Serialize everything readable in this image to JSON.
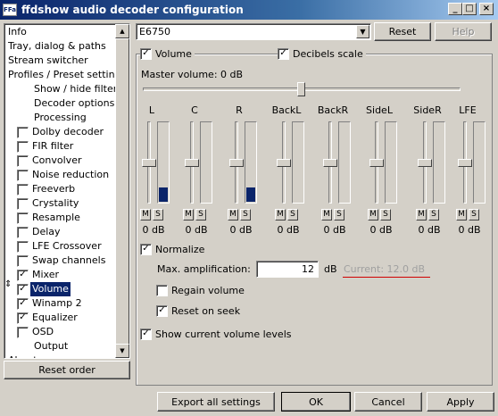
{
  "window": {
    "title": "ffdshow audio decoder configuration",
    "icon_text": "FFa",
    "minimize_glyph": "_",
    "maximize_glyph": "□",
    "close_glyph": "×"
  },
  "tree": {
    "items": [
      {
        "label": "Info",
        "indent": 0,
        "checkbox": false
      },
      {
        "label": "Tray, dialog & paths",
        "indent": 0,
        "checkbox": false
      },
      {
        "label": "Stream switcher",
        "indent": 0,
        "checkbox": false
      },
      {
        "label": "Profiles / Preset settings",
        "indent": 0,
        "checkbox": false
      },
      {
        "label": "Show / hide filters",
        "indent": 1,
        "checkbox": false
      },
      {
        "label": "Decoder options",
        "indent": 1,
        "checkbox": false
      },
      {
        "label": "Processing",
        "indent": 1,
        "checkbox": false
      },
      {
        "label": "Dolby decoder",
        "indent": 1,
        "checkbox": true,
        "checked": false
      },
      {
        "label": "FIR filter",
        "indent": 1,
        "checkbox": true,
        "checked": false
      },
      {
        "label": "Convolver",
        "indent": 1,
        "checkbox": true,
        "checked": false
      },
      {
        "label": "Noise reduction",
        "indent": 1,
        "checkbox": true,
        "checked": false
      },
      {
        "label": "Freeverb",
        "indent": 1,
        "checkbox": true,
        "checked": false
      },
      {
        "label": "Crystality",
        "indent": 1,
        "checkbox": true,
        "checked": false
      },
      {
        "label": "Resample",
        "indent": 1,
        "checkbox": true,
        "checked": false
      },
      {
        "label": "Delay",
        "indent": 1,
        "checkbox": true,
        "checked": false
      },
      {
        "label": "LFE Crossover",
        "indent": 1,
        "checkbox": true,
        "checked": false
      },
      {
        "label": "Swap channels",
        "indent": 1,
        "checkbox": true,
        "checked": false
      },
      {
        "label": "Mixer",
        "indent": 1,
        "checkbox": true,
        "checked": true
      },
      {
        "label": "Volume",
        "indent": 1,
        "checkbox": true,
        "checked": true,
        "selected": true
      },
      {
        "label": "Winamp 2",
        "indent": 1,
        "checkbox": true,
        "checked": true
      },
      {
        "label": "Equalizer",
        "indent": 1,
        "checkbox": true,
        "checked": true
      },
      {
        "label": "OSD",
        "indent": 1,
        "checkbox": true,
        "checked": false
      },
      {
        "label": "Output",
        "indent": 1,
        "checkbox": false
      },
      {
        "label": "About",
        "indent": 0,
        "checkbox": false
      }
    ],
    "drag_glyph": "⇕",
    "scroll_up": "▲",
    "scroll_down": "▼"
  },
  "preset": {
    "value": "E6750",
    "dropdown_glyph": "▼",
    "reset_label": "Reset",
    "help_label": "Help"
  },
  "volume": {
    "volume_label": "Volume",
    "volume_checked": true,
    "db_scale_label": "Decibels scale",
    "db_scale_checked": true,
    "master_label": "Master volume: 0 dB",
    "master_level": 0.5,
    "m_label": "M",
    "s_label": "S",
    "channels": [
      {
        "name": "L",
        "db": "0 dB",
        "meter": 0.18
      },
      {
        "name": "C",
        "db": "0 dB",
        "meter": 0
      },
      {
        "name": "R",
        "db": "0 dB",
        "meter": 0.18
      },
      {
        "name": "BackL",
        "db": "0 dB",
        "meter": 0
      },
      {
        "name": "BackR",
        "db": "0 dB",
        "meter": 0
      },
      {
        "name": "SideL",
        "db": "0 dB",
        "meter": 0
      },
      {
        "name": "SideR",
        "db": "0 dB",
        "meter": 0
      },
      {
        "name": "LFE",
        "db": "0 dB",
        "meter": 0
      }
    ],
    "normalize_label": "Normalize",
    "normalize_checked": true,
    "max_amp_label": "Max. amplification:",
    "max_amp_value": "12",
    "max_amp_unit": "dB",
    "current_label": "Current: 12.0 dB",
    "regain_label": "Regain volume",
    "regain_checked": false,
    "reset_on_seek_label": "Reset on seek",
    "reset_on_seek_checked": true,
    "show_levels_label": "Show current volume levels",
    "show_levels_checked": true
  },
  "footer": {
    "reset_order_label": "Reset order",
    "export_label": "Export all settings",
    "ok_label": "OK",
    "cancel_label": "Cancel",
    "apply_label": "Apply"
  }
}
